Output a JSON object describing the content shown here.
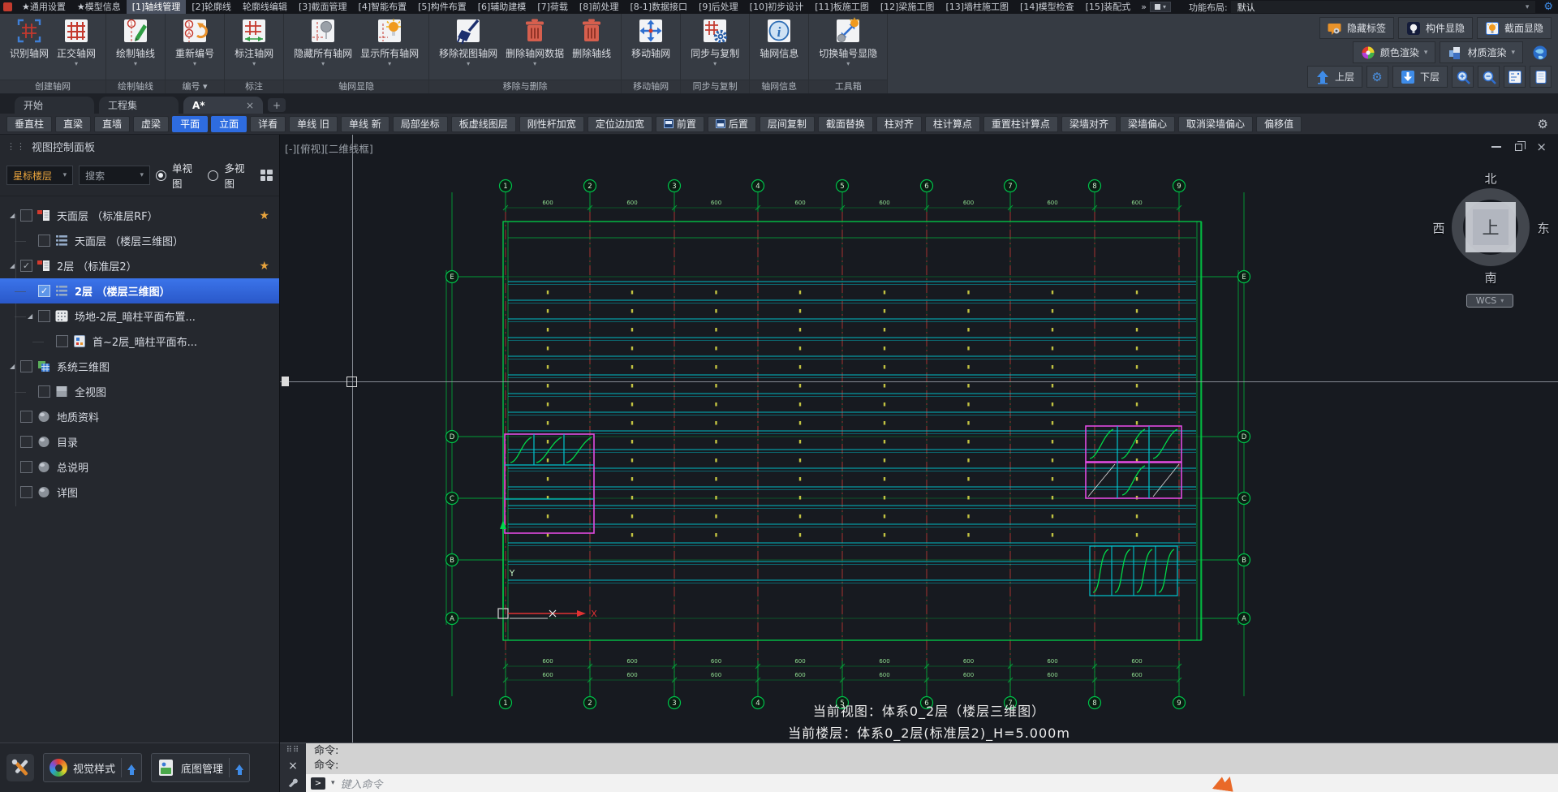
{
  "colors": {
    "accent_blue": "#2e6ce0",
    "selection_blue": "#2f62d6",
    "axis_green": "#00b33c",
    "beam_cyan": "#00c4ce",
    "axis_red": "#b73333",
    "magenta": "#e04ae0",
    "tag_yellow": "#d6d645",
    "star_orange": "#e8a33c"
  },
  "menu": {
    "items": [
      "★通用设置",
      "★模型信息",
      "[1]轴线管理",
      "[2]轮廓线",
      "轮廓线编辑",
      "[3]截面管理",
      "[4]智能布置",
      "[5]构件布置",
      "[6]辅助建模",
      "[7]荷载",
      "[8]前处理",
      "[8-1]数据接口",
      "[9]后处理",
      "[10]初步设计",
      "[11]板施工图",
      "[12]梁施工图",
      "[13]墙柱施工图",
      "[14]模型检查",
      "[15]装配式"
    ],
    "active_index": 2,
    "overflow_icon": "chevrons-right",
    "layout_label": "功能布局:",
    "layout_value": "默认"
  },
  "ribbon": {
    "groups": [
      {
        "label": "创建轴网",
        "buttons": [
          {
            "label": "识别轴网",
            "icon": "grid-detect"
          },
          {
            "label": "正交轴网",
            "icon": "grid-ortho",
            "dd": true
          }
        ]
      },
      {
        "label": "绘制轴线",
        "buttons": [
          {
            "label": "绘制轴线",
            "icon": "draw-axis",
            "dd": true
          }
        ]
      },
      {
        "label": "编号",
        "dd": true,
        "buttons": [
          {
            "label": "重新编号",
            "icon": "renumber",
            "dd": true
          }
        ]
      },
      {
        "label": "标注",
        "buttons": [
          {
            "label": "标注轴网",
            "icon": "dim-grid",
            "dd": true
          }
        ]
      },
      {
        "label": "轴网显隐",
        "buttons": [
          {
            "label": "隐藏所有轴网",
            "icon": "hide-grid",
            "dd": true
          },
          {
            "label": "显示所有轴网",
            "icon": "show-grid",
            "dd": true
          }
        ]
      },
      {
        "label": "移除与删除",
        "buttons": [
          {
            "label": "移除视图轴网",
            "icon": "broom",
            "dd": true
          },
          {
            "label": "删除轴网数据",
            "icon": "trash",
            "dd": true
          },
          {
            "label": "删除轴线",
            "icon": "trash"
          }
        ]
      },
      {
        "label": "移动轴网",
        "buttons": [
          {
            "label": "移动轴网",
            "icon": "move"
          }
        ]
      },
      {
        "label": "同步与复制",
        "buttons": [
          {
            "label": "同步与复制",
            "icon": "sync",
            "dd": true
          }
        ]
      },
      {
        "label": "轴网信息",
        "buttons": [
          {
            "label": "轴网信息",
            "icon": "info"
          }
        ]
      },
      {
        "label": "工具箱",
        "buttons": [
          {
            "label": "切换轴号显隐",
            "icon": "toggle",
            "dd": true
          }
        ]
      }
    ],
    "right": {
      "row1": [
        {
          "label": "隐藏标签",
          "icon": "tag-hide"
        },
        {
          "label": "构件显隐",
          "icon": "bulb-dark"
        },
        {
          "label": "截面显隐",
          "icon": "bulb-box"
        }
      ],
      "row2": [
        {
          "label": "颜色渲染",
          "icon": "color-wheel",
          "dd": true
        },
        {
          "label": "材质渲染",
          "icon": "material",
          "dd": true
        },
        {
          "icon": "earth"
        }
      ],
      "row3": [
        {
          "label": "上层",
          "icon": "up-arrow"
        },
        {
          "icon": "gear"
        },
        {
          "label": "下层",
          "icon": "down-arrow-box"
        },
        {
          "icon": "zoom-in"
        },
        {
          "icon": "zoom-out"
        },
        {
          "icon": "panel-list"
        },
        {
          "icon": "panel-doc"
        }
      ]
    }
  },
  "tabs": {
    "items": [
      {
        "label": "开始"
      },
      {
        "label": "工程集"
      },
      {
        "label": "A*",
        "closable": true,
        "active": true
      }
    ],
    "add_label": "+"
  },
  "toolbar": {
    "buttons": [
      {
        "label": "垂直柱"
      },
      {
        "label": "直梁"
      },
      {
        "label": "直墙"
      },
      {
        "label": "虚梁"
      },
      {
        "label": "平面",
        "active": true
      },
      {
        "label": "立面",
        "active": true
      },
      {
        "label": "详看"
      },
      {
        "label": "单线 旧"
      },
      {
        "label": "单线 新"
      },
      {
        "label": "局部坐标"
      },
      {
        "label": "板虚线图层"
      },
      {
        "label": "刚性杆加宽"
      },
      {
        "label": "定位边加宽"
      },
      {
        "label": "前置",
        "icon": "front"
      },
      {
        "label": "后置",
        "icon": "back"
      },
      {
        "label": "层间复制"
      },
      {
        "label": "截面替换"
      },
      {
        "label": "柱对齐"
      },
      {
        "label": "柱计算点"
      },
      {
        "label": "重置柱计算点"
      },
      {
        "label": "梁墙对齐"
      },
      {
        "label": "梁墙偏心"
      },
      {
        "label": "取消梁墙偏心"
      },
      {
        "label": "偏移值"
      }
    ]
  },
  "sidebar": {
    "title": "视图控制面板",
    "filter_value": "星标楼层",
    "search_placeholder": "搜索",
    "radio_single": "单视图",
    "radio_multi": "多视图",
    "tree": [
      {
        "label": "天面层 （标准层RF）",
        "level": 0,
        "expander": true,
        "checked": false,
        "star": true,
        "icon": "layer"
      },
      {
        "label": "天面层 （楼层三维图）",
        "level": 1,
        "checked": false,
        "icon": "list"
      },
      {
        "label": "2层 （标准层2）",
        "level": 0,
        "expander": true,
        "checked": true,
        "star": true,
        "icon": "layer"
      },
      {
        "label": "2层 （楼层三维图）",
        "level": 1,
        "checked": true,
        "selected": true,
        "icon": "list"
      },
      {
        "label": "场地-2层_暗柱平面布置...",
        "level": 1,
        "expander": true,
        "checked": false,
        "icon": "griddoc"
      },
      {
        "label": "首~2层_暗柱平面布...",
        "level": 2,
        "checked": false,
        "icon": "smalldoc"
      },
      {
        "label": "系统三维图",
        "level": 0,
        "expander": true,
        "checked": false,
        "icon": "cube"
      },
      {
        "label": "全视图",
        "level": 1,
        "checked": false,
        "icon": "graysq"
      },
      {
        "label": "地质资料",
        "level": 0,
        "checked": false,
        "icon": "sphere"
      },
      {
        "label": "目录",
        "level": 0,
        "checked": false,
        "icon": "sphere"
      },
      {
        "label": "总说明",
        "level": 0,
        "checked": false,
        "icon": "sphere"
      },
      {
        "label": "详图",
        "level": 0,
        "checked": false,
        "icon": "sphere"
      }
    ],
    "bottom": {
      "visual_style": "视觉样式",
      "base_map": "底图管理"
    }
  },
  "canvas": {
    "viewport_label": "[-][俯视][二维线框]",
    "compass": {
      "north": "北",
      "south": "南",
      "east": "东",
      "west": "西",
      "up": "上",
      "wcs": "WCS"
    },
    "axis_numbers": [
      "1",
      "2",
      "3",
      "4",
      "5",
      "6",
      "7",
      "8",
      "9"
    ],
    "axis_letters": [
      "E",
      "D",
      "C",
      "B",
      "A"
    ],
    "dims": {
      "top": [
        "600",
        "600",
        "600",
        "600",
        "600",
        "600",
        "600",
        "600"
      ],
      "bottom": [
        "600",
        "600",
        "600",
        "600",
        "600",
        "600",
        "600",
        "600"
      ]
    },
    "ucs": {
      "x": "X",
      "y": "Y"
    },
    "status_line1": "当前视图：体系0_2层（楼层三维图）",
    "status_line2": "当前楼层：体系0_2层(标准层2)_H=5.000m"
  },
  "command": {
    "history": [
      "命令:",
      "命令:"
    ],
    "placeholder": "键入命令"
  }
}
